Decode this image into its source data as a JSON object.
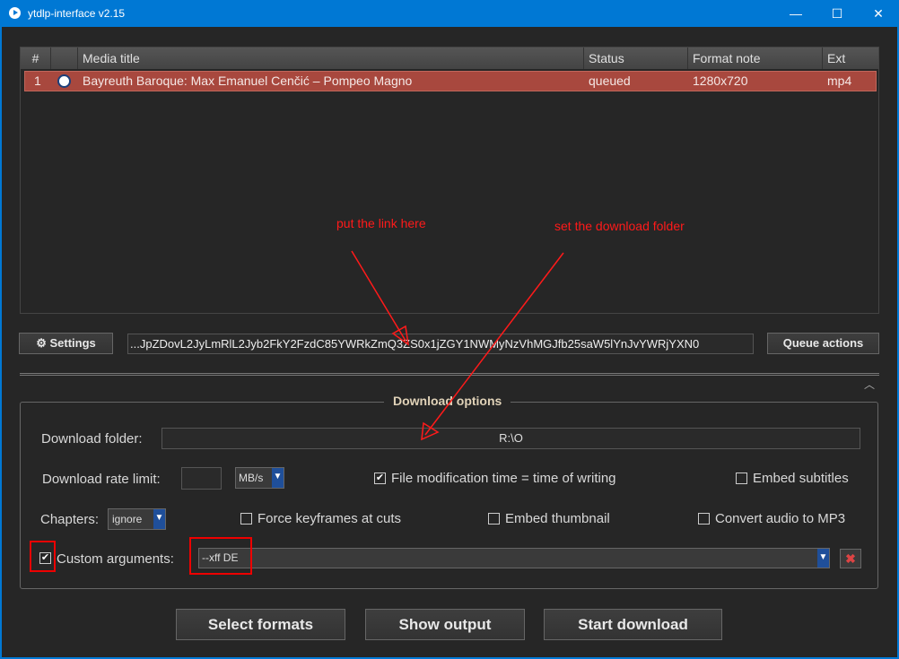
{
  "window": {
    "title": "ytdlp-interface v2.15",
    "minimize": "—",
    "maximize": "☐",
    "close": "✕"
  },
  "table": {
    "columns": [
      "#",
      "",
      "Media title",
      "Status",
      "Format note",
      "Ext"
    ],
    "rows": [
      {
        "num": "1",
        "icon": "site-logo-icon",
        "title": "Bayreuth Baroque: Max Emanuel Cenčić – Pompeo Magno",
        "status": "queued",
        "format_note": "1280x720",
        "ext": "mp4"
      }
    ]
  },
  "toolbar": {
    "settings_label": "Settings",
    "url_value": "...JpZDovL2JyLmRlL2Jyb2FkY2FzdC85YWRkZmQ3ZS0x1jZGY1NWMyNzVhMGJfb25saW5lYnJvYWRjYXN0",
    "queue_actions_label": "Queue actions"
  },
  "options": {
    "group_title": "Download options",
    "download_folder_label": "Download folder:",
    "download_folder_value": "R:\\O",
    "rate_limit_label": "Download rate limit:",
    "rate_limit_value": "",
    "rate_unit": "MB/s",
    "file_mod_time_label": "File modification time = time of writing",
    "file_mod_time_checked": true,
    "embed_subtitles_label": "Embed subtitles",
    "embed_subtitles_checked": false,
    "chapters_label": "Chapters:",
    "chapters_value": "ignore",
    "force_keyframes_label": "Force keyframes at cuts",
    "force_keyframes_checked": false,
    "embed_thumbnail_label": "Embed thumbnail",
    "embed_thumbnail_checked": false,
    "convert_mp3_label": "Convert audio to MP3",
    "convert_mp3_checked": false,
    "custom_args_label": "Custom arguments:",
    "custom_args_checked": true,
    "custom_args_value": "--xff DE"
  },
  "actions": {
    "select_formats": "Select formats",
    "show_output": "Show output",
    "start_download": "Start download"
  },
  "annotations": {
    "link_hint": "put the link here",
    "folder_hint": "set the download folder"
  },
  "colors": {
    "accent": "#0078d4",
    "selected_row": "#a8483e",
    "annotation": "#ff1a1a"
  }
}
